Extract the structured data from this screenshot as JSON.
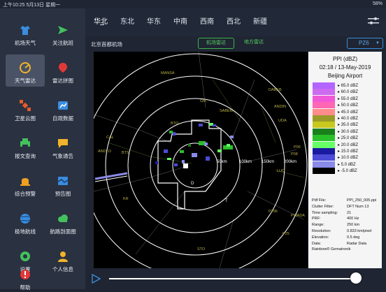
{
  "status_bar": {
    "time_date": "上午10:25  5月13日 星期一",
    "battery": "58%"
  },
  "sidebar": {
    "items": [
      {
        "label": "机场天气",
        "icon": "shirt-icon"
      },
      {
        "label": "关注航班",
        "icon": "paper-plane-icon"
      },
      {
        "label": "天气雷达",
        "icon": "radar-icon"
      },
      {
        "label": "雷达拼图",
        "icon": "pin-icon"
      },
      {
        "label": "卫星云图",
        "icon": "satellite-icon"
      },
      {
        "label": "自观数据",
        "icon": "chart-icon"
      },
      {
        "label": "报文查询",
        "icon": "printer-icon"
      },
      {
        "label": "气象通告",
        "icon": "message-icon"
      },
      {
        "label": "综合预警",
        "icon": "warning-light-icon"
      },
      {
        "label": "预告图",
        "icon": "map-icon"
      },
      {
        "label": "极地航线",
        "icon": "globe-icon"
      },
      {
        "label": "航路剖面图",
        "icon": "cloud-icon"
      },
      {
        "label": "设置",
        "icon": "settings-icon"
      },
      {
        "label": "个人信息",
        "icon": "user-icon"
      },
      {
        "label": "帮助",
        "icon": "help-icon"
      }
    ]
  },
  "region_tabs": [
    "华北",
    "东北",
    "华东",
    "中南",
    "西南",
    "西北",
    "新疆"
  ],
  "station_name": "北京首都机场",
  "buttons": {
    "airport_radar": "机场雷达",
    "local_radar": "地方雷达"
  },
  "product": {
    "selected": "PZ6"
  },
  "radar": {
    "range_labels": [
      "50km",
      "100km",
      "150km",
      "200km"
    ],
    "place_labels": [
      "MANSA",
      "GM",
      "SABEM",
      "DABEB",
      "ANDIN",
      "UDA",
      "P06",
      "P08",
      "LUO",
      "P296",
      "PWADA",
      "P25",
      "STO",
      "KR",
      "CAL",
      "BTO",
      "ANDLO",
      "BTS",
      "D",
      "T"
    ]
  },
  "legend": {
    "title": "PPI (dBZ)",
    "time": "02:18 / 13-May-2019",
    "site": "Beijing Airport",
    "scale": [
      {
        "label": "65.0 dBZ",
        "color": "#b366ff"
      },
      {
        "label": "60.0 dBZ",
        "color": "#cc6bf0"
      },
      {
        "label": "55.0 dBZ",
        "color": "#f058d8"
      },
      {
        "label": "50.0 dBZ",
        "color": "#ff66b3"
      },
      {
        "label": "45.0 dBZ",
        "color": "#ff8c8c"
      },
      {
        "label": "40.0 dBZ",
        "color": "#9a9a2a"
      },
      {
        "label": "35.0 dBZ",
        "color": "#c8c81e"
      },
      {
        "label": "30.0 dBZ",
        "color": "#1a801a"
      },
      {
        "label": "25.0 dBZ",
        "color": "#2ac02a"
      },
      {
        "label": "20.0 dBZ",
        "color": "#66ff66"
      },
      {
        "label": "15.0 dBZ",
        "color": "#1a1aa0"
      },
      {
        "label": "10.0 dBZ",
        "color": "#4b4bd6"
      },
      {
        "label": "5.0 dBZ",
        "color": "#8a8ae8"
      },
      {
        "label": "-5.0 dBZ",
        "color": "#000000"
      }
    ],
    "info": [
      {
        "k": "Pdf File:",
        "v": "PPI_250_005.ppi"
      },
      {
        "k": "Clutter Filter:",
        "v": "DFT Num 13"
      },
      {
        "k": "Time sampling:",
        "v": "21"
      },
      {
        "k": "PRF:",
        "v": "400 Hz"
      },
      {
        "k": "Range:",
        "v": "250 km"
      },
      {
        "k": "Resolution:",
        "v": "0.833 km/pixel"
      },
      {
        "k": "Elevation:",
        "v": "0.5 deg"
      },
      {
        "k": "Data:",
        "v": "Radar Data"
      },
      {
        "k": "Rainbow® Gematronik",
        "v": ""
      }
    ]
  },
  "playback": {
    "position": 0.98
  }
}
